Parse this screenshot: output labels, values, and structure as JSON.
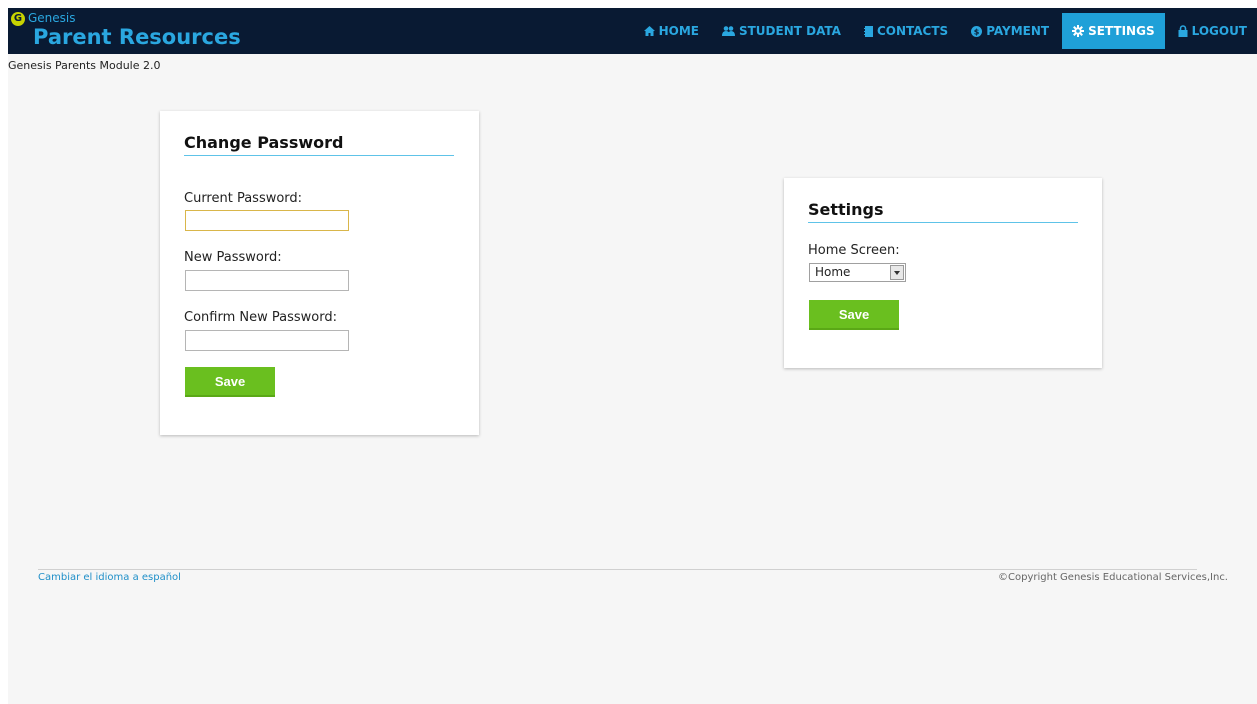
{
  "header": {
    "brand_small": "Genesis",
    "brand_title": "Parent Resources",
    "nav": [
      {
        "label": "HOME",
        "icon": "home-icon"
      },
      {
        "label": "STUDENT DATA",
        "icon": "users-icon"
      },
      {
        "label": "CONTACTS",
        "icon": "contacts-book-icon"
      },
      {
        "label": "PAYMENT",
        "icon": "payment-icon"
      },
      {
        "label": "SETTINGS",
        "icon": "gear-icon",
        "active": true
      },
      {
        "label": "LOGOUT",
        "icon": "lock-icon"
      }
    ]
  },
  "module_label": "Genesis Parents Module 2.0",
  "change_password": {
    "title": "Change Password",
    "current_label": "Current Password:",
    "current_value": "",
    "new_label": "New Password:",
    "new_value": "",
    "confirm_label": "Confirm New Password:",
    "confirm_value": "",
    "save_label": "Save"
  },
  "settings": {
    "title": "Settings",
    "home_screen_label": "Home Screen:",
    "home_screen_value": "Home",
    "save_label": "Save"
  },
  "footer": {
    "language_link": "Cambiar el idioma a español",
    "copyright": "©Copyright Genesis Educational Services,Inc."
  },
  "colors": {
    "header_bg": "#091a33",
    "accent": "#2aa7e0",
    "active_tab": "#1fa0d8",
    "save_button": "#6abf1f"
  }
}
